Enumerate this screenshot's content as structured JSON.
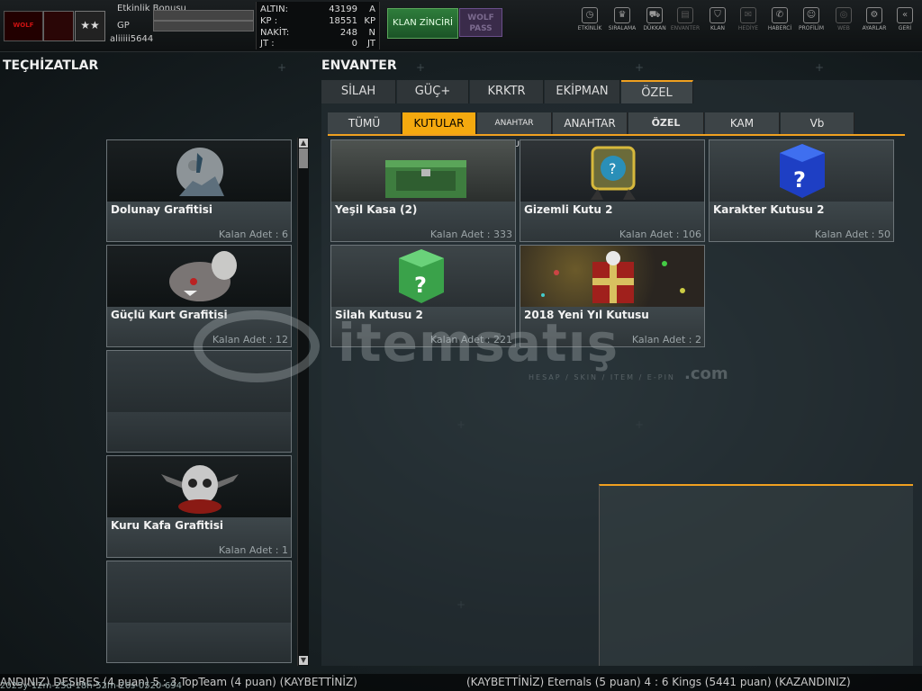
{
  "player": {
    "event_bonus_label": "Etkinlik Bonusu",
    "gp_label": "GP",
    "username": "aliiiii5644",
    "logo_text": "WOLF"
  },
  "currency": [
    {
      "label": "ALTIN:",
      "value": "43199",
      "unit": "A"
    },
    {
      "label": "KP :",
      "value": "18551",
      "unit": "KP"
    },
    {
      "label": "NAKİT:",
      "value": "248",
      "unit": "N"
    },
    {
      "label": "JT :",
      "value": "0",
      "unit": "JT"
    }
  ],
  "top_buttons": {
    "klan_zinciri": "KLAN ZİNCİRİ",
    "wolf_pass": "WOLF PASS"
  },
  "nav": [
    {
      "label": "ETKİNLİK",
      "icon": "stopwatch-icon",
      "glyph": "◷"
    },
    {
      "label": "SIRALAMA",
      "icon": "medal-icon",
      "glyph": "♛"
    },
    {
      "label": "DÜKKAN",
      "icon": "cart-icon",
      "glyph": "⛟"
    },
    {
      "label": "ENVANTER",
      "icon": "inventory-icon",
      "glyph": "▤"
    },
    {
      "label": "KLAN",
      "icon": "shield-icon",
      "glyph": "⛉"
    },
    {
      "label": "HEDİYE",
      "icon": "gift-icon",
      "glyph": "✉"
    },
    {
      "label": "HABERCİ",
      "icon": "megaphone-icon",
      "glyph": "✆"
    },
    {
      "label": "PROFİLİM",
      "icon": "profile-icon",
      "glyph": "☺"
    },
    {
      "label": "WEB",
      "icon": "globe-icon",
      "glyph": "◎"
    },
    {
      "label": "AYARLAR",
      "icon": "gear-icon",
      "glyph": "⚙"
    },
    {
      "label": "GERİ",
      "icon": "back-icon",
      "glyph": "«"
    }
  ],
  "left": {
    "title": "TEÇHİZATLAR",
    "items": [
      {
        "name": "Dolunay Grafitisi",
        "count": "Kalan Adet : 6"
      },
      {
        "name": "Güçlü Kurt Grafitisi",
        "count": "Kalan Adet : 12"
      },
      {
        "name": "",
        "count": ""
      },
      {
        "name": "Kuru Kafa Grafitisi",
        "count": "Kalan Adet : 1"
      },
      {
        "name": "",
        "count": ""
      }
    ]
  },
  "inventory": {
    "title": "ENVANTER",
    "tabs": [
      "SİLAH",
      "GÜÇ+",
      "KRKTR",
      "EKİPMAN",
      "ÖZEL"
    ],
    "active_tab": "ÖZEL",
    "subtabs": [
      "TÜMÜ",
      "KUTULAR",
      "ANAHTAR KUTUSU",
      "ANAHTAR",
      "ÖZEL EŞYALAR",
      "KAM",
      "Vb"
    ],
    "active_subtab": "KUTULAR",
    "items": [
      {
        "name": "Yeşil Kasa (2)",
        "count": "Kalan Adet : 333"
      },
      {
        "name": "Gizemli Kutu 2",
        "count": "Kalan Adet : 106"
      },
      {
        "name": "Karakter Kutusu 2",
        "count": "Kalan Adet : 50"
      },
      {
        "name": "Silah Kutusu 2",
        "count": "Kalan Adet : 221"
      },
      {
        "name": "2018 Yeni Yıl Kutusu",
        "count": "Kalan Adet : 2"
      }
    ]
  },
  "watermark": {
    "brand": "itemsatış",
    "tld": ".com",
    "tagline": "HESAP / SKIN / ITEM / E-PIN"
  },
  "ticker": {
    "left": "ANDINIZ) DESIRES (4 puan) 5 : 3 TopTeam (4 puan) (KAYBETTİNİZ)",
    "overlay": "2025y-12m-25d-18h-52m-26s-0520-694",
    "right": "(KAYBETTİNİZ) Eternals (5 puan) 4 : 6 Kings (5441 puan) (KAZANDINIZ)"
  }
}
